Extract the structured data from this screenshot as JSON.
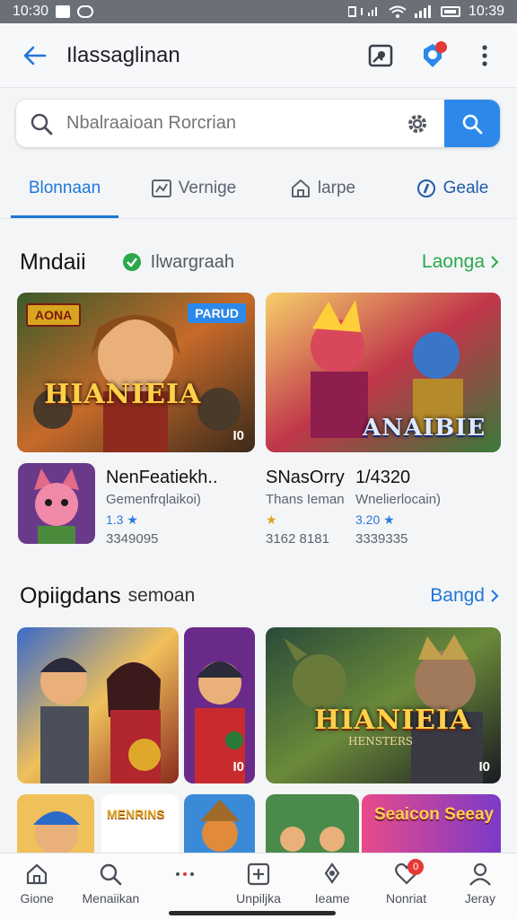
{
  "status": {
    "time_left": "10:30",
    "time_right": "10:39"
  },
  "app_bar": {
    "title": "Ilassaglinan",
    "icons": [
      "arrow-left-icon",
      "image-icon",
      "badge-icon",
      "more-vert-icon"
    ]
  },
  "search": {
    "placeholder": "Nbalraaioan Rorcrian"
  },
  "tabs": [
    {
      "label": "Blonnaan",
      "icon": "none",
      "active": true
    },
    {
      "label": "Vernige",
      "icon": "chart-icon",
      "active": false
    },
    {
      "label": "larpe",
      "icon": "home-icon",
      "active": false
    },
    {
      "label": "Geale",
      "icon": "compass-icon",
      "active": false
    }
  ],
  "section1": {
    "title": "Mndaii",
    "subtitle": "Ilwargraah",
    "link": "Laonga",
    "cards": [
      {
        "title": "HIANIEIA",
        "tag": "AONA",
        "badge": "PARUD",
        "corner": "I0"
      },
      {
        "title": "ANAIBIE",
        "corner": ""
      }
    ],
    "apps": [
      {
        "name": "NenFeatiekh..",
        "sub": "Gemenfrqlaikoi)",
        "rating": "1.3 ★",
        "count": "3349095"
      },
      {
        "name": "SNasOrry",
        "sub": "Thans Ieman",
        "rating": "★",
        "count": "3162 8181"
      },
      {
        "name": "1/4320",
        "sub": "Wnelierlocain)",
        "rating": "3.20 ★",
        "count": "3339335"
      }
    ]
  },
  "section2": {
    "title": "Opiigdans",
    "title_suffix": "semoan",
    "link": "Bangd",
    "cards": [
      {
        "title": "HIANIEIA",
        "subtitle": "HENSTERS",
        "corner": "I0"
      },
      {
        "title": "HIANIEIA",
        "subtitle": "HENSTERS",
        "corner": "I0"
      }
    ],
    "row3": [
      {
        "title": "Seaicon Seeay"
      },
      {
        "title": "MENRINS"
      }
    ]
  },
  "bottom_nav": [
    {
      "label": "Gione",
      "icon": "home-icon"
    },
    {
      "label": "Menaiikan",
      "icon": "search-icon"
    },
    {
      "label": "",
      "icon": "dots-icon"
    },
    {
      "label": "Unpiljka",
      "icon": "plus-square-icon"
    },
    {
      "label": "Ieame",
      "icon": "rocket-icon"
    },
    {
      "label": "Nonriat",
      "icon": "heart-icon",
      "badge": "0"
    },
    {
      "label": "Jeray",
      "icon": "person-icon"
    }
  ],
  "colors": {
    "accent": "#1f77d8",
    "green": "#2aa84a",
    "badge": "#e53935"
  }
}
